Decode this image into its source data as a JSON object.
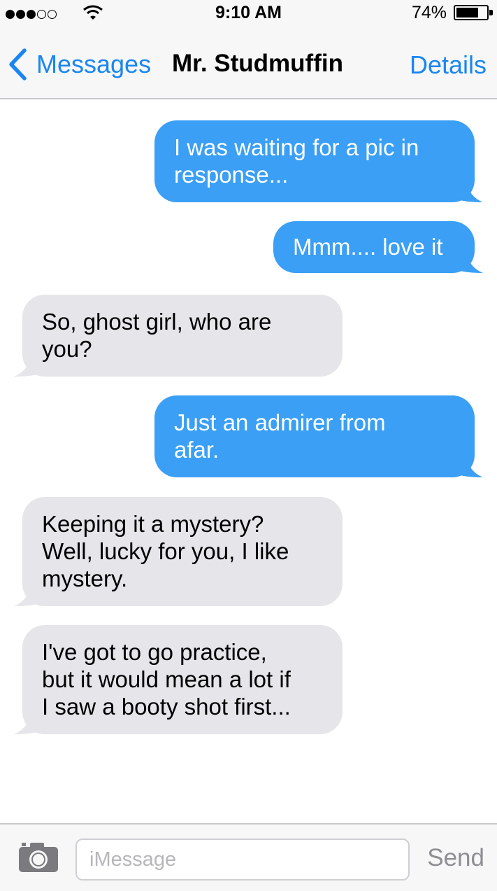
{
  "status_bar": {
    "signal_bars_filled": 3,
    "signal_bars_total": 5,
    "time": "9:10 AM",
    "battery_percent_label": "74%",
    "battery_level": 0.74
  },
  "nav": {
    "back_label": "Messages",
    "title": "Mr. Studmuffin",
    "details_label": "Details"
  },
  "messages": [
    {
      "direction": "sent",
      "text": "I was waiting for a pic in\nresponse..."
    },
    {
      "direction": "sent",
      "text": "Mmm.... love it"
    },
    {
      "direction": "received",
      "text": "So, ghost girl, who are\nyou?"
    },
    {
      "direction": "sent",
      "text": "Just an admirer from\nafar."
    },
    {
      "direction": "received",
      "text": "Keeping it a mystery?\nWell, lucky for you, I like\nmystery."
    },
    {
      "direction": "received",
      "text": "I've got to go practice,\nbut it would mean a lot if\nI saw a booty shot first..."
    }
  ],
  "composer": {
    "camera_icon": "camera-icon",
    "placeholder": "iMessage",
    "value": "",
    "send_label": "Send"
  },
  "colors": {
    "accent": "#1a86f0",
    "sent_bubble": "#3a9ff5",
    "received_bubble": "#e5e5ea"
  }
}
